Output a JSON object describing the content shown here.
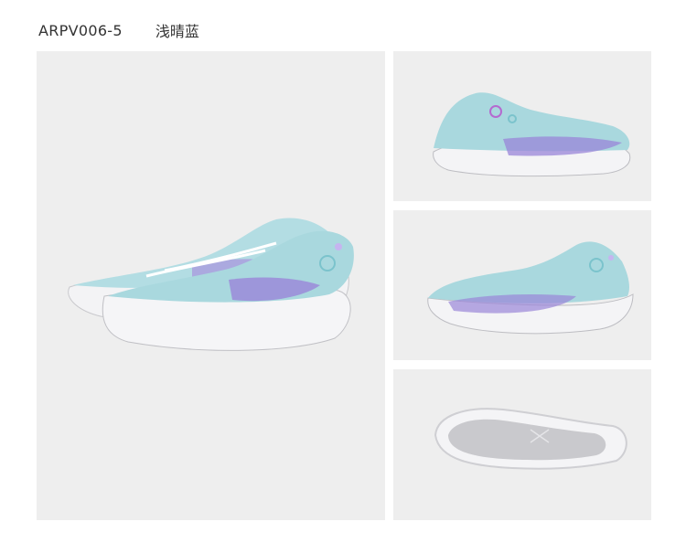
{
  "product": {
    "code": "ARPV006-5",
    "color_name": "浅晴蓝"
  },
  "images": [
    {
      "view": "pair-angled",
      "icon": "shoe-pair-icon"
    },
    {
      "view": "side-medial",
      "icon": "shoe-side-icon"
    },
    {
      "view": "side-lateral",
      "icon": "shoe-side-icon"
    },
    {
      "view": "outsole",
      "icon": "shoe-sole-icon"
    }
  ],
  "colors": {
    "background": "#eeeeee",
    "upper": "#a9d8de",
    "upper_light": "#d6eef1",
    "accent_purple": "#9a86d8",
    "midsole": "#f4f4f6",
    "sole_grey": "#b9b9bd",
    "text": "#333333"
  }
}
